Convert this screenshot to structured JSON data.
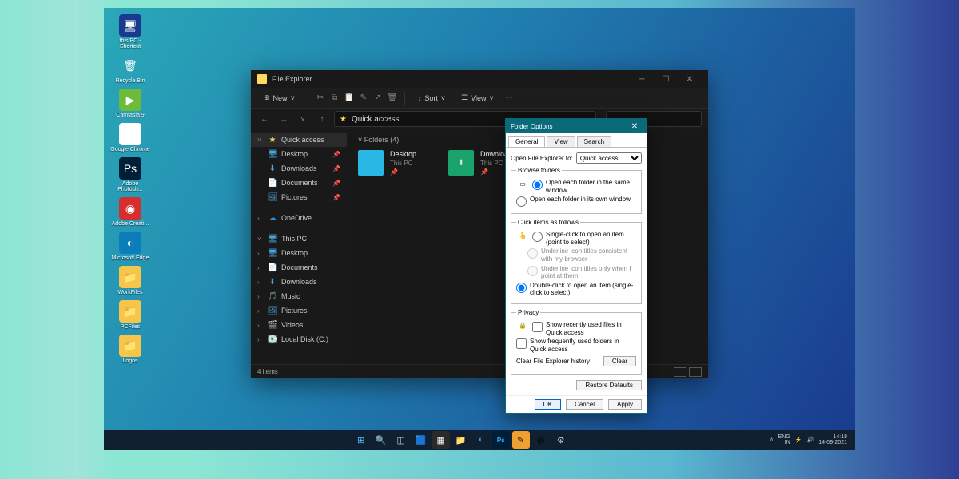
{
  "desktop": {
    "icons": [
      {
        "label": "this PC - Shortcut",
        "bg": "#1a3a8e",
        "glyph": "🖥"
      },
      {
        "label": "Recycle Bin",
        "bg": "transparent",
        "glyph": "🗑"
      },
      {
        "label": "Camtasia 9",
        "bg": "#6dbb3a",
        "glyph": "▶"
      },
      {
        "label": "Google Chrome",
        "bg": "#fff",
        "glyph": "◎"
      },
      {
        "label": "Adobe Photosh...",
        "bg": "#001e36",
        "glyph": "Ps"
      },
      {
        "label": "Adobe Creati...",
        "bg": "#d62e2e",
        "glyph": "◉"
      },
      {
        "label": "Microsoft Edge",
        "bg": "#0b7dba",
        "glyph": "◐"
      },
      {
        "label": "WorkFiles",
        "bg": "#f6c64a",
        "glyph": "📁"
      },
      {
        "label": "PCFiles",
        "bg": "#f6c64a",
        "glyph": "📁"
      },
      {
        "label": "Logos",
        "bg": "#f6c64a",
        "glyph": "📁"
      }
    ]
  },
  "explorer": {
    "title": "File Explorer",
    "toolbar": {
      "new": "New",
      "sort": "Sort",
      "view": "View"
    },
    "breadcrumb": "Quick access",
    "section_header": "Folders (4)",
    "folders": [
      {
        "name": "Desktop",
        "sub": "This PC",
        "color": "#29b7e6"
      },
      {
        "name": "Downloads",
        "sub": "This PC",
        "color": "#1aa36a"
      }
    ],
    "sidebar": {
      "quick": "Quick access",
      "quick_items": [
        "Desktop",
        "Downloads",
        "Documents",
        "Pictures"
      ],
      "onedrive": "OneDrive",
      "thispc": "This PC",
      "pc_items": [
        "Desktop",
        "Documents",
        "Downloads",
        "Music",
        "Pictures",
        "Videos",
        "Local Disk (C:)"
      ]
    },
    "status": "4 items"
  },
  "dialog": {
    "title": "Folder Options",
    "tabs": [
      "General",
      "View",
      "Search"
    ],
    "open_label": "Open File Explorer to:",
    "open_value": "Quick access",
    "browse": {
      "legend": "Browse folders",
      "opt1": "Open each folder in the same window",
      "opt2": "Open each folder in its own window"
    },
    "click": {
      "legend": "Click items as follows",
      "opt1": "Single-click to open an item (point to select)",
      "opt1a": "Underline icon titles consistent with my browser",
      "opt1b": "Underline icon titles only when I point at them",
      "opt2": "Double-click to open an item (single-click to select)"
    },
    "privacy": {
      "legend": "Privacy",
      "opt1": "Show recently used files in Quick access",
      "opt2": "Show frequently used folders in Quick access",
      "clear_label": "Clear File Explorer history",
      "clear_btn": "Clear"
    },
    "restore": "Restore Defaults",
    "ok": "OK",
    "cancel": "Cancel",
    "apply": "Apply"
  },
  "taskbar": {
    "lang": "ENG\nIN",
    "time": "14:18",
    "date": "14-09-2021"
  }
}
